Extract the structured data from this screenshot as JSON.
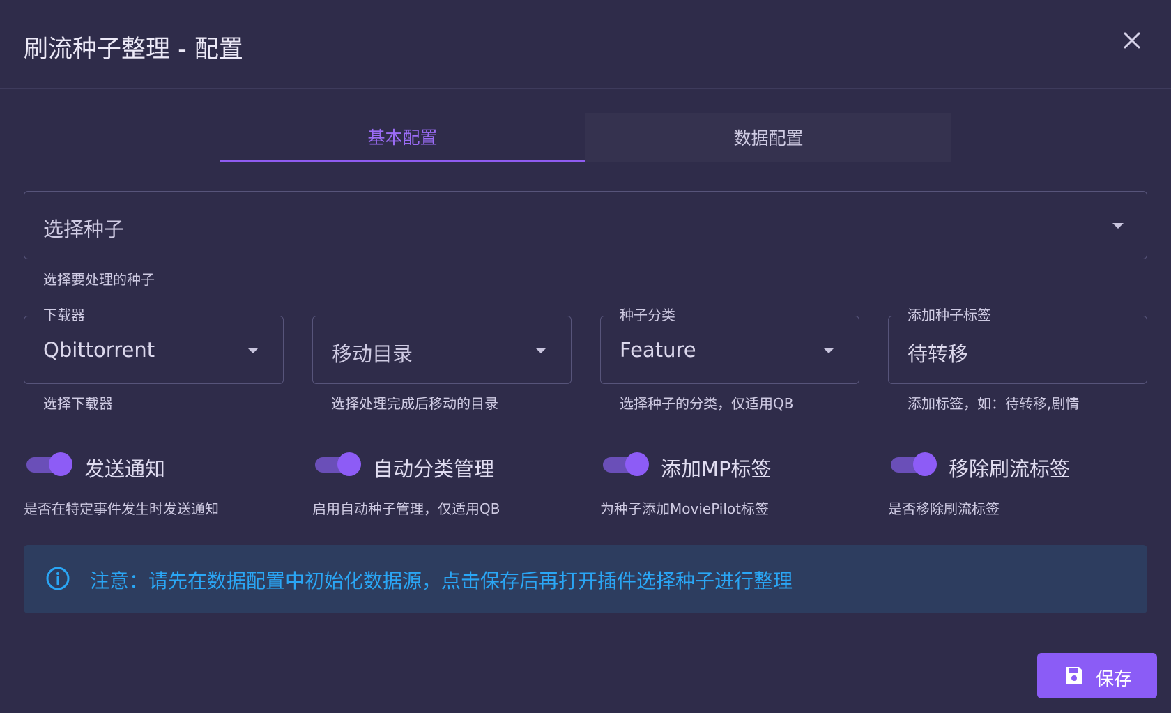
{
  "dialog": {
    "title": "刷流种子整理 - 配置",
    "close_icon": "close-icon"
  },
  "tabs": [
    {
      "label": "基本配置",
      "active": true
    },
    {
      "label": "数据配置",
      "active": false
    }
  ],
  "torrent_select": {
    "placeholder": "选择种子",
    "hint": "选择要处理的种子"
  },
  "downloader": {
    "label": "下载器",
    "value": "Qbittorrent",
    "hint": "选择下载器"
  },
  "move_dir": {
    "placeholder": "移动目录",
    "hint": "选择处理完成后移动的目录"
  },
  "category": {
    "label": "种子分类",
    "value": "Feature",
    "hint": "选择种子的分类，仅适用QB"
  },
  "add_tag": {
    "label": "添加种子标签",
    "value": "待转移",
    "hint": "添加标签，如：待转移,剧情"
  },
  "switches": [
    {
      "label": "发送通知",
      "hint": "是否在特定事件发生时发送通知",
      "on": true
    },
    {
      "label": "自动分类管理",
      "hint": "启用自动种子管理，仅适用QB",
      "on": true
    },
    {
      "label": "添加MP标签",
      "hint": "为种子添加MoviePilot标签",
      "on": true
    },
    {
      "label": "移除刷流标签",
      "hint": "是否移除刷流标签",
      "on": true
    }
  ],
  "alert": {
    "icon": "info-icon",
    "text": "注意：请先在数据配置中初始化数据源，点击保存后再打开插件选择种子进行整理"
  },
  "save": {
    "label": "保存",
    "icon": "save-icon"
  },
  "colors": {
    "accent": "#8b5cf6",
    "background": "#2f2c4a",
    "info": "#2aa6f5"
  }
}
